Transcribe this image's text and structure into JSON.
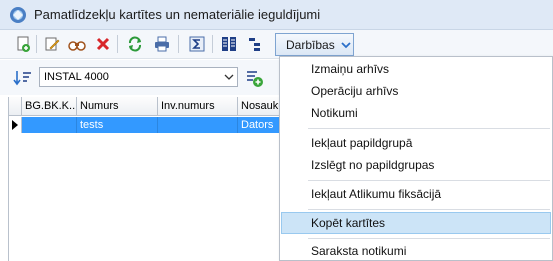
{
  "window": {
    "title": "Pamatlīdzekļu kartītes un nemateriālie ieguldījumi"
  },
  "toolbar": {
    "menu_label": "Darbības"
  },
  "filter": {
    "selected_value": "INSTAL 4000"
  },
  "grid": {
    "columns": [
      "BG.BK.K...",
      "Numurs",
      "Inv.numurs",
      "Nosaukum"
    ],
    "rows": [
      {
        "bgbk": "",
        "numurs": "tests",
        "inv": "",
        "nosaukums": "Dators"
      }
    ]
  },
  "menu": {
    "items": [
      "Izmaiņu arhīvs",
      "Operāciju arhīvs",
      "Notikumi",
      "Iekļaut papildgrupā",
      "Izslēgt no papildgrupas",
      "Iekļaut Atlikumu fiksācijā",
      "Kopēt kartītes",
      "Saraksta notikumi"
    ],
    "highlighted": "Kopēt kartītes"
  },
  "colors": {
    "titlebar": "#dfe9f6",
    "selection": "#3399ff",
    "menu_highlight": "#cce4f7"
  }
}
